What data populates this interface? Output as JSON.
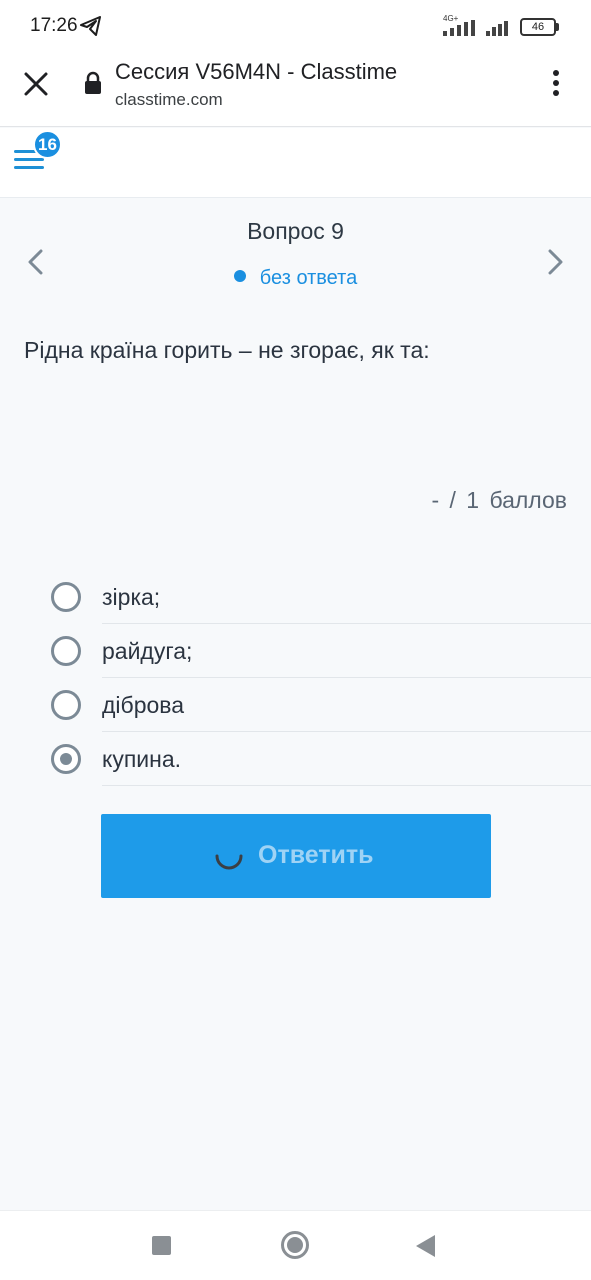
{
  "status_bar": {
    "time": "17:26",
    "network_type": "4G+",
    "battery": "46"
  },
  "browser": {
    "title": "Сессия V56M4N - Classtime",
    "url": "classtime.com"
  },
  "header": {
    "notification_count": "16"
  },
  "question": {
    "title": "Вопрос 9",
    "status": "без ответа",
    "text": "Рідна країна горить – не згорає, як та:",
    "score": "- / 1 баллов"
  },
  "options": [
    {
      "label": "зірка;",
      "selected": false
    },
    {
      "label": "райдуга;",
      "selected": false
    },
    {
      "label": "діброва",
      "selected": false
    },
    {
      "label": "купина.",
      "selected": true
    }
  ],
  "submit": {
    "label": "Ответить"
  },
  "colors": {
    "accent": "#1a8fe0",
    "button": "#1e9be9",
    "radio": "#7c8a96"
  }
}
